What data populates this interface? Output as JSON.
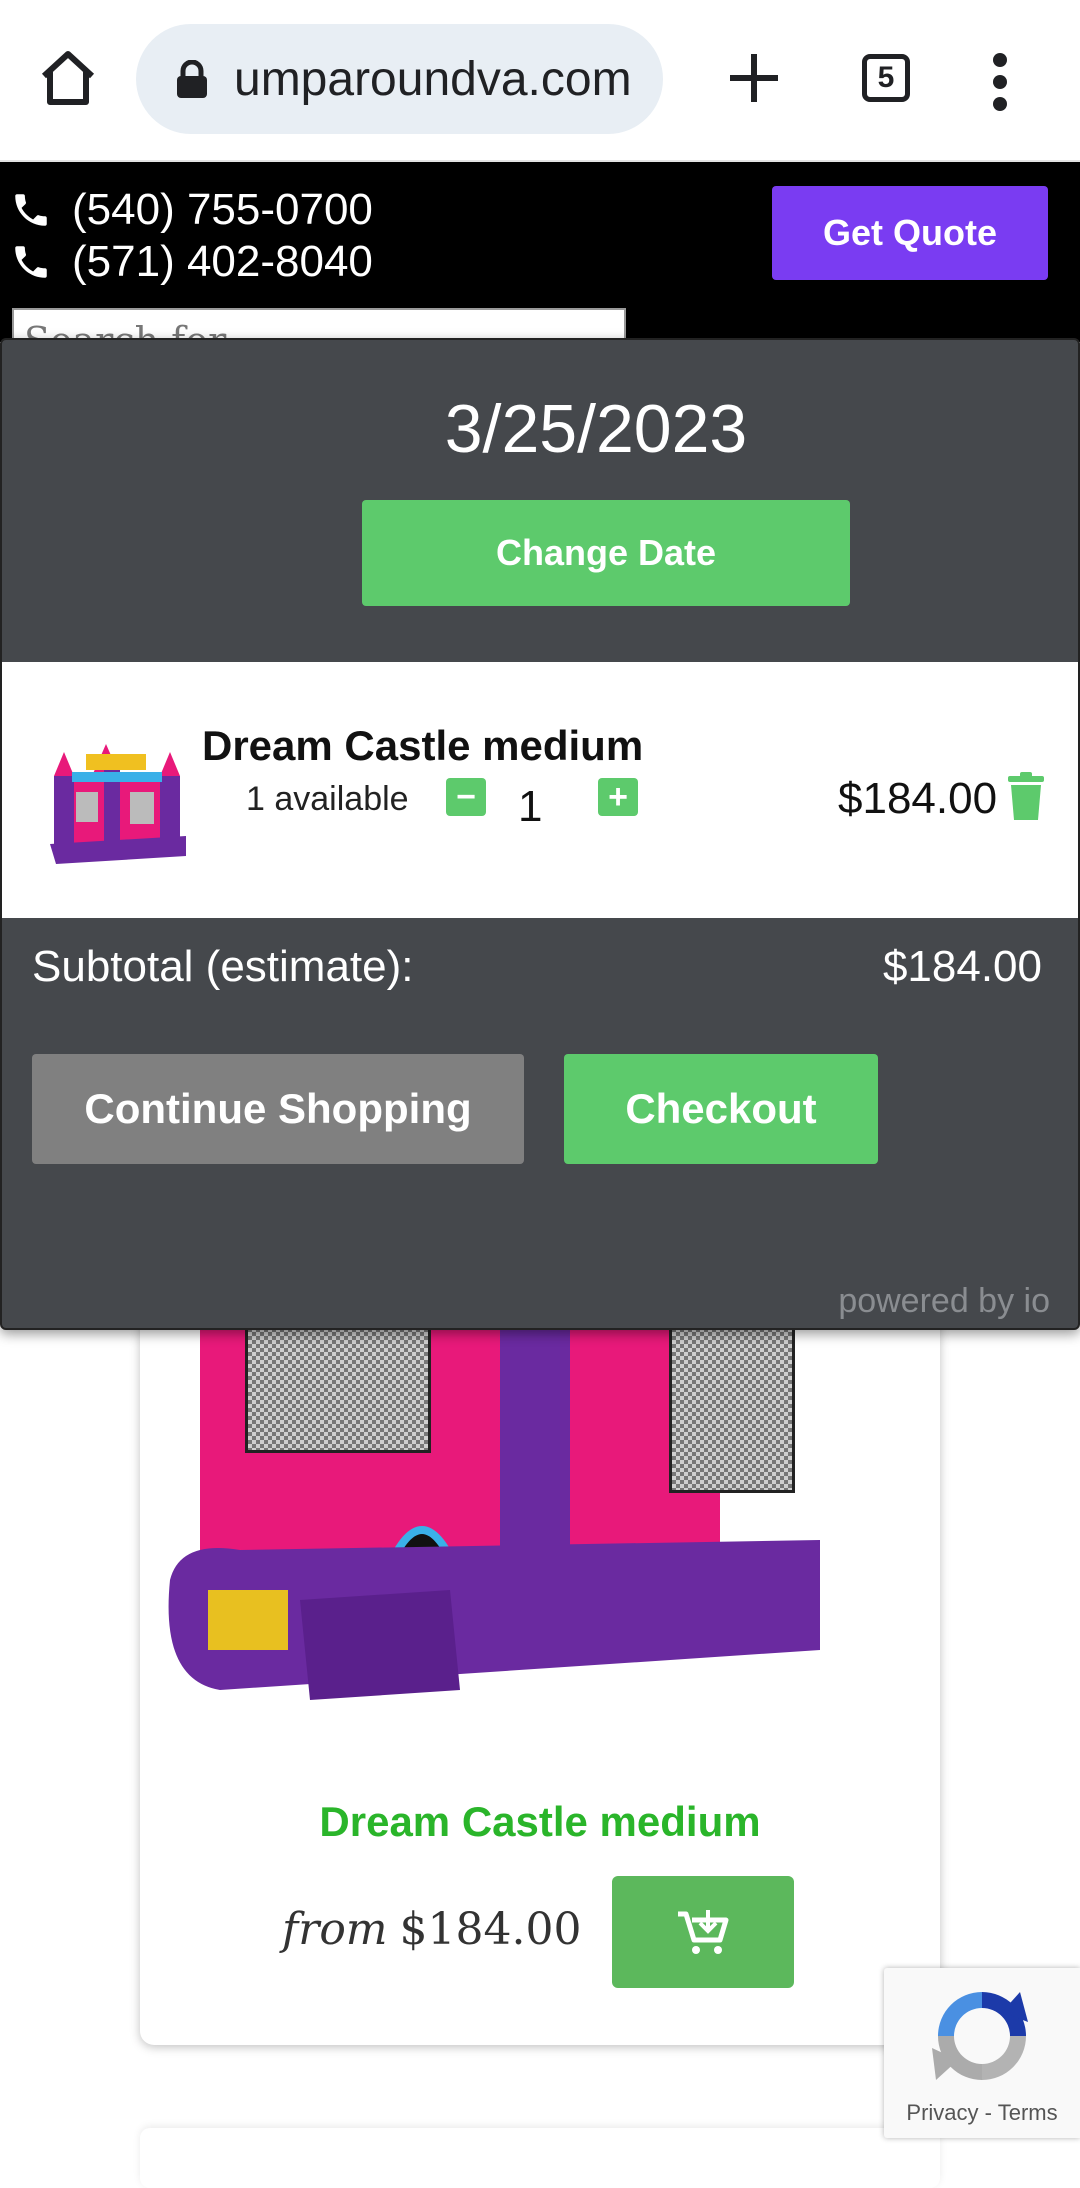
{
  "browser": {
    "url": "umparoundva.com",
    "tab_count": "5"
  },
  "header": {
    "phones": [
      "(540) 755-0700",
      "(571) 402-8040"
    ],
    "get_quote_label": "Get Quote",
    "search_placeholder": "Search for"
  },
  "cart": {
    "date": "3/25/2023",
    "change_date_label": "Change Date",
    "item": {
      "name": "Dream Castle medium",
      "availability": "1 available",
      "quantity": "1",
      "minus_label": "−",
      "plus_label": "+",
      "price": "$184.00"
    },
    "subtotal_label": "Subtotal (estimate):",
    "subtotal_value": "$184.00",
    "continue_label": "Continue Shopping",
    "checkout_label": "Checkout",
    "powered_by": "powered by io"
  },
  "product": {
    "name": "Dream Castle medium",
    "from_label": "from",
    "price": "$184.00"
  },
  "recaptcha": {
    "privacy": "Privacy",
    "separator": "-",
    "terms": "Terms"
  },
  "icons": {
    "home": "home-icon",
    "lock": "lock-icon",
    "new_tab": "plus-icon",
    "tabs": "tabs-icon",
    "menu": "kebab-menu-icon",
    "phone": "phone-icon",
    "trash": "trash-icon",
    "cart": "add-to-cart-icon"
  },
  "colors": {
    "accent_purple": "#7a3cf2",
    "accent_green": "#5dca6c",
    "modal_bg": "#45484c",
    "product_title_green": "#2ab52a"
  }
}
